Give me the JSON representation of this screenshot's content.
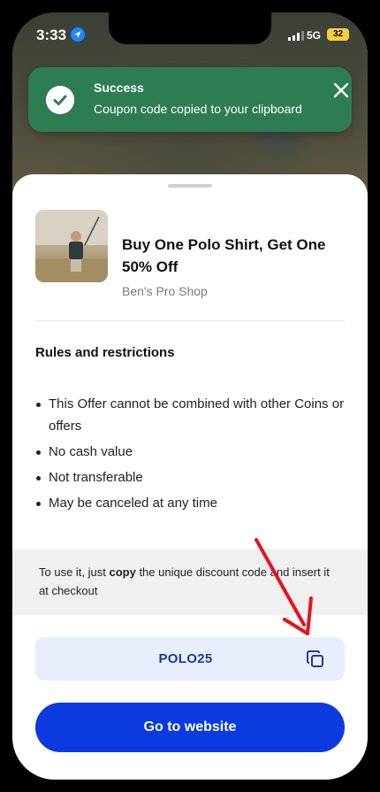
{
  "status_bar": {
    "time": "3:33",
    "network": "5G",
    "battery": "32"
  },
  "toast": {
    "title": "Success",
    "message": "Coupon code copied to your clipboard",
    "color": "#2e7d52"
  },
  "offer": {
    "title": "Buy One Polo Shirt, Get One 50% Off",
    "shop": "Ben's Pro Shop"
  },
  "rules": {
    "heading": "Rules and restrictions",
    "items": [
      "This Offer cannot be combined with other Coins or offers",
      "No cash value",
      "Not transferable",
      "May be canceled at any time"
    ]
  },
  "instructions": {
    "before": "To use it, just ",
    "bold": "copy",
    "after": " the unique discount code and insert it at checkout"
  },
  "coupon": {
    "code": "POLO25"
  },
  "actions": {
    "go_to_website": "Go to website"
  },
  "colors": {
    "primary": "#0a3ae0",
    "success": "#2e7d52",
    "annotation": "#e8121b"
  }
}
